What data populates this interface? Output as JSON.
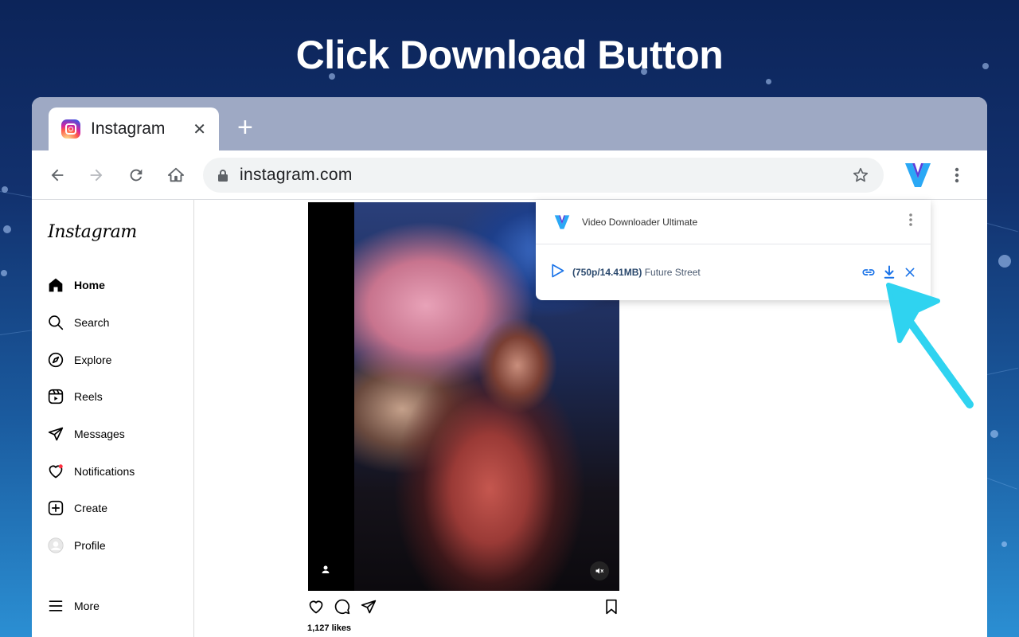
{
  "headline": "Click Download Button",
  "browser": {
    "tab": {
      "title": "Instagram",
      "favicon_icon": "instagram-icon"
    },
    "address": "instagram.com"
  },
  "instagram": {
    "logo": "Instagram",
    "nav": [
      {
        "label": "Home",
        "icon": "home-icon",
        "active": true
      },
      {
        "label": "Search",
        "icon": "search-icon"
      },
      {
        "label": "Explore",
        "icon": "compass-icon"
      },
      {
        "label": "Reels",
        "icon": "reels-icon"
      },
      {
        "label": "Messages",
        "icon": "send-icon"
      },
      {
        "label": "Notifications",
        "icon": "heart-icon"
      },
      {
        "label": "Create",
        "icon": "plus-square-icon"
      },
      {
        "label": "Profile",
        "icon": "avatar-icon"
      },
      {
        "label": "More",
        "icon": "menu-icon"
      }
    ],
    "post": {
      "likes": "1,127 likes"
    }
  },
  "extension": {
    "title": "Video Downloader Ultimate",
    "item": {
      "quality": "(750p/14.41MB)",
      "name": "Future Street"
    }
  },
  "colors": {
    "accent": "#1a73e8",
    "pointer": "#2fd3f0",
    "brand_v": "#3b7cf0"
  }
}
